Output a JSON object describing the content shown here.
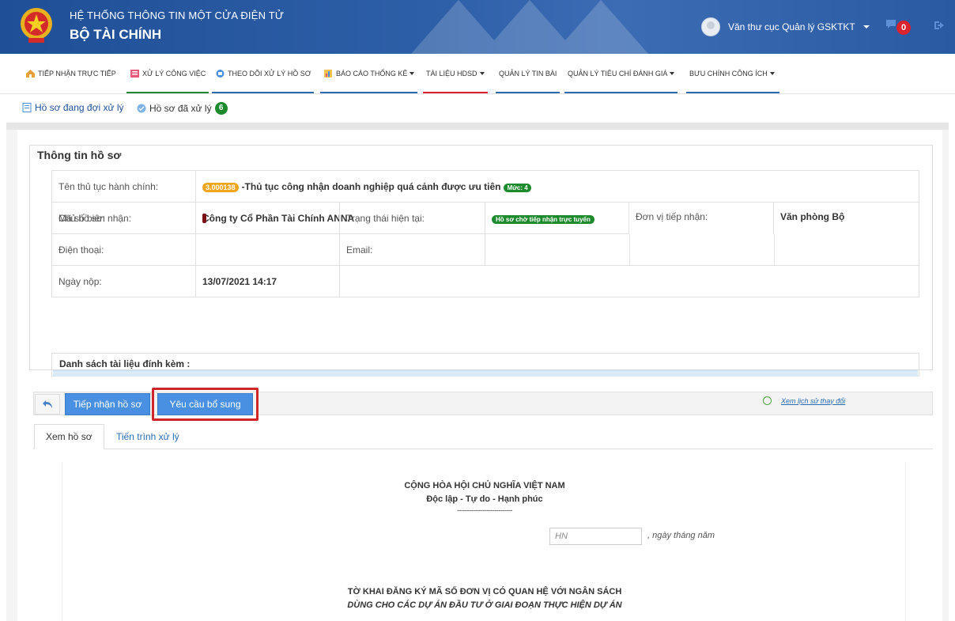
{
  "header": {
    "system_title": "HỆ THỐNG THÔNG TIN MỘT CỬA ĐIỆN TỬ",
    "ministry": "BỘ TÀI CHÍNH",
    "user_name": "Văn thư cục Quản lý GSKTKT",
    "notification_count": "0",
    "colors": {
      "primary": "#1f4f96",
      "badge": "#d9232d"
    }
  },
  "nav": {
    "items": [
      {
        "label": "TIẾP NHẬN TRỰC TIẾP",
        "icon": "home-icon",
        "line_color": ""
      },
      {
        "label": "XỬ LÝ CÔNG VIỆC",
        "icon": "task-icon",
        "line_color": "#1e8a2e"
      },
      {
        "label": "THEO DÕI XỬ LÝ HỒ SƠ",
        "icon": "track-icon",
        "line_color": "#2b6cb3"
      },
      {
        "label": "BÁO CÁO THỐNG KÊ",
        "icon": "report-icon",
        "line_color": "#2b6cb3"
      },
      {
        "label": "TÀI LIỆU HDSD",
        "icon": "",
        "line_color": "#d9232d"
      },
      {
        "label": "QUẢN LÝ TIN BÀI",
        "icon": "",
        "line_color": "#2b6cb3"
      },
      {
        "label": "QUẢN LÝ TIÊU CHÍ ĐÁNH GIÁ",
        "icon": "",
        "line_color": "#2b6cb3"
      },
      {
        "label": "BƯU CHÍNH CÔNG ÍCH",
        "icon": "",
        "line_color": "#2b6cb3"
      }
    ]
  },
  "subtabs": {
    "pending": "Hồ sơ đang đợi xử lý",
    "done": "Hồ sơ đã xử lý",
    "done_count": "6"
  },
  "info": {
    "panel_title": "Thông tin hồ sơ",
    "procedure_label": "Tên thủ tục hành chính:",
    "procedure_code": "3.000138",
    "procedure_name": "-Thủ tục công nhận doanh nghiệp quá cảnh được ưu tiên",
    "procedure_level": "Mức: 4",
    "owner_label": "Chủ hồ sơ:",
    "owner_value": "Công ty Cổ Phần Tài Chính ANNA",
    "receiver_label": "Đơn vị tiếp nhận:",
    "receiver_value": "Văn phòng Bộ",
    "receipt_label": "Mã số biên nhận:",
    "status_label": "Trạng thái hiện tại:",
    "status_value": "Hồ sơ chờ tiếp nhận trực tuyến",
    "phone_label": "Điện thoại:",
    "email_label": "Email:",
    "date_label": "Ngày nộp:",
    "date_value": "13/07/2021 14:17",
    "attach_label": "Danh sách tài liệu đính kèm :"
  },
  "actions": {
    "receive": "Tiếp nhận hồ sơ",
    "request_more": "Yêu cầu bổ sung",
    "history": "Xem lịch sử thay đổi"
  },
  "tabs": {
    "view": "Xem hồ sơ",
    "progress": "Tiến trình xử lý"
  },
  "document": {
    "heading1": "CỘNG HÒA HỘI CHỦ NGHĨA VIỆT NAM",
    "heading2": "Độc lập - Tự do - Hạnh phúc",
    "dashes": "----------------------------",
    "place_value": "HN",
    "date_text": ", ngày  tháng   năm",
    "title1": "TỜ KHAI ĐĂNG KÝ MÃ SỐ ĐƠN VỊ CÓ QUAN HỆ VỚI NGÂN SÁCH",
    "title2": "DÙNG CHO CÁC DỰ ÁN ĐẦU TƯ Ở GIAI ĐOẠN THỰC HIỆN DỰ ÁN"
  }
}
